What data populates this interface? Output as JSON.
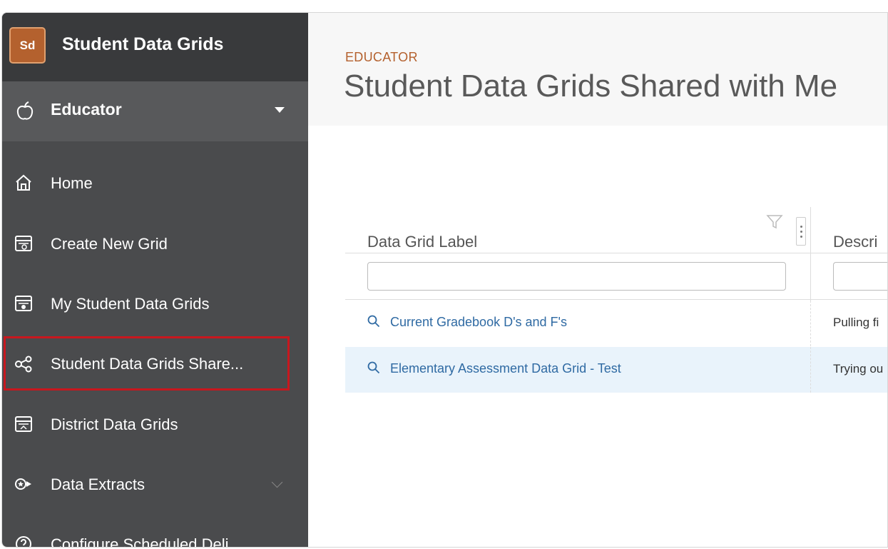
{
  "app": {
    "logo_text": "Sd",
    "title": "Student Data Grids"
  },
  "role": {
    "label": "Educator"
  },
  "sidebar": {
    "items": [
      {
        "label": "Home",
        "icon": "home-icon"
      },
      {
        "label": "Create New Grid",
        "icon": "grid-create-icon"
      },
      {
        "label": "My Student Data Grids",
        "icon": "grid-personal-icon"
      },
      {
        "label": "Student Data Grids Share...",
        "icon": "share-icon",
        "active": true
      },
      {
        "label": "District Data Grids",
        "icon": "grid-district-icon"
      },
      {
        "label": "Data Extracts",
        "icon": "data-extract-icon",
        "expandable": true
      },
      {
        "label": "Configure Scheduled Deli...",
        "icon": "question-icon"
      }
    ]
  },
  "header": {
    "eyebrow": "EDUCATOR",
    "title": "Student Data Grids Shared with Me"
  },
  "grid": {
    "columns": [
      "Data Grid Label",
      "Descri"
    ],
    "rows": [
      {
        "label": "Current Gradebook D's and F's",
        "description": "Pulling fi"
      },
      {
        "label": "Elementary Assessment Data Grid - Test",
        "description": "Trying ou"
      }
    ]
  },
  "colors": {
    "accent": "#b4612e",
    "link": "#2f6aa3",
    "active_outline": "#c8171e",
    "row_highlight": "#e9f3fb"
  }
}
